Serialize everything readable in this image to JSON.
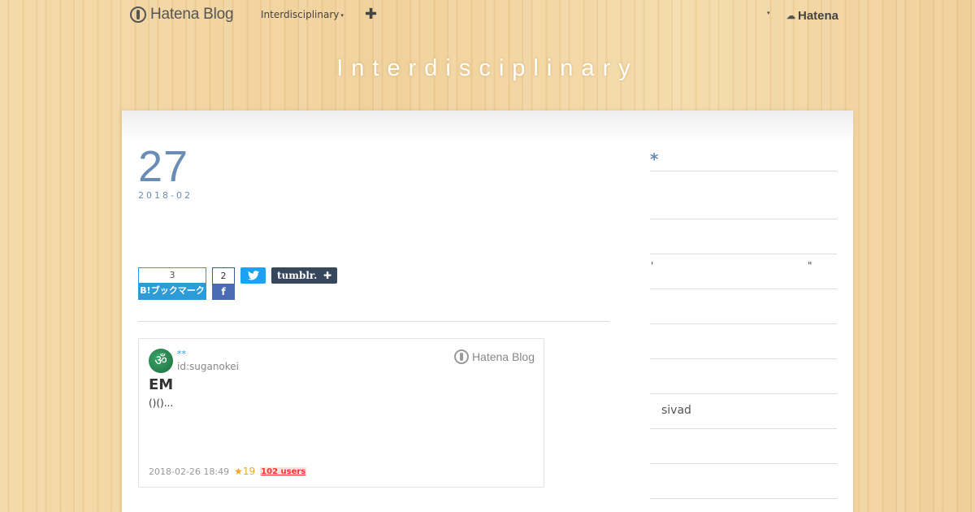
{
  "topbar": {
    "brand": "Hatena Blog",
    "blog_menu": "Interdisciplinary",
    "caret": "▾",
    "add": "✚",
    "user_caret": "▾",
    "hatena": "Hatena"
  },
  "blog": {
    "title": "Interdisciplinary"
  },
  "entry": {
    "day": "27",
    "year_month": "2018-02"
  },
  "share": {
    "hatena_count": "3",
    "hatena_label": "B!ブックマーク",
    "facebook_count": "2",
    "facebook_icon": "f",
    "twitter_icon": "twitter-icon",
    "tumblr_label": "tumblr.",
    "tumblr_plus": "✚"
  },
  "card": {
    "author": "**",
    "user_id": "id:suganokei",
    "brand": "Hatena Blog",
    "title": "EM",
    "description": "()()...",
    "timestamp": "2018-02-26 18:49",
    "stars": "★19",
    "users": "102 users",
    "avatar_glyph": "ॐ"
  },
  "sidebar": {
    "asterisk": "*",
    "quote_open": "'",
    "quote_close": "\"",
    "item_sivad": "sivad"
  },
  "colors": {
    "accent": "#6a8db5",
    "hatena_blue": "#2c9bd6",
    "facebook": "#4b6cb3",
    "twitter": "#1da1f2",
    "tumblr": "#36465d",
    "users_red": "#ff3333"
  }
}
